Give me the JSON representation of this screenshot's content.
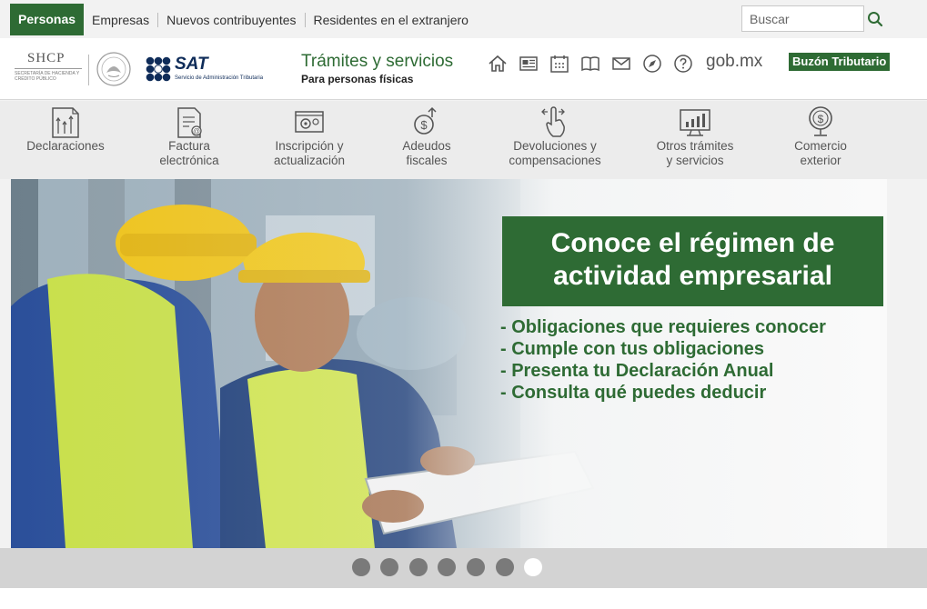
{
  "topnav": {
    "active_tab": "Personas",
    "links": [
      "Empresas",
      "Nuevos contribuyentes",
      "Residentes en el extranjero"
    ],
    "search_placeholder": "Buscar"
  },
  "header": {
    "shcp_title": "SHCP",
    "shcp_subtitle": "SECRETARÍA DE HACIENDA Y CRÉDITO PÚBLICO",
    "sat_name": "SAT",
    "sat_subtitle": "Servicio de Administración Tributaria",
    "section_title": "Trámites y servicios",
    "section_subtitle": "Para personas físicas",
    "icons": [
      "home-icon",
      "news-icon",
      "calendar-icon",
      "book-icon",
      "mail-icon",
      "compass-icon",
      "help-icon"
    ],
    "gobmx": "gob.mx",
    "buzon": "Buzón Tributario"
  },
  "services": [
    {
      "label": "Declaraciones",
      "icon": "declaraciones-icon"
    },
    {
      "label": "Factura\nelectrónica",
      "icon": "factura-icon"
    },
    {
      "label": "Inscripción y\nactualización",
      "icon": "inscripcion-icon"
    },
    {
      "label": "Adeudos\nfiscales",
      "icon": "adeudos-icon"
    },
    {
      "label": "Devoluciones y\ncompensaciones",
      "icon": "devoluciones-icon"
    },
    {
      "label": "Otros trámites\ny servicios",
      "icon": "otros-tramites-icon"
    },
    {
      "label": "Comercio\nexterior",
      "icon": "comercio-exterior-icon"
    }
  ],
  "hero": {
    "title": "Conoce el régimen de actividad empresarial",
    "items": [
      "- Obligaciones que requieres conocer",
      "- Cumple con tus obligaciones",
      "- Presenta tu Declaración Anual",
      "- Consulta qué puedes deducir"
    ]
  },
  "carousel": {
    "total_slides": 7,
    "active_slide": 7
  },
  "colors": {
    "brand_green": "#2e6b34",
    "dark_blue": "#0f2c59",
    "dot_inactive": "#7a7a7a",
    "dot_active": "#ffffff"
  }
}
